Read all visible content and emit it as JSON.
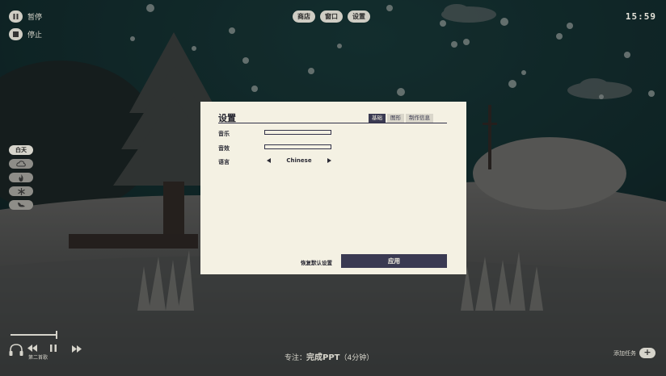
{
  "topbar": {
    "pause_label": "暂停",
    "stop_label": "停止",
    "tabs": [
      {
        "label": "商店"
      },
      {
        "label": "窗口"
      },
      {
        "label": "设置"
      }
    ],
    "clock": "15:59"
  },
  "sidebar": {
    "scene_label": "白天",
    "icons": [
      "cloud-icon",
      "fire-icon",
      "snowflake-icon",
      "bird-icon"
    ]
  },
  "settings": {
    "title": "设置",
    "tabs": [
      {
        "label": "基础",
        "active": true
      },
      {
        "label": "图形",
        "active": false
      },
      {
        "label": "制作信息",
        "active": false
      }
    ],
    "music_label": "音乐",
    "music_level": 0,
    "sfx_label": "音效",
    "sfx_level": 0,
    "language_label": "语言",
    "language_value": "Chinese",
    "reset_label": "恢复默认设置",
    "apply_label": "应用"
  },
  "player": {
    "track_label": "第二首歌",
    "progress": 1.0
  },
  "focus": {
    "prefix": "专注：",
    "task": "完成PPT",
    "duration": "（4分钟）"
  },
  "add_task_label": "添加任务",
  "colors": {
    "panel": "#f4f1e3",
    "accent": "#3a3a52",
    "sky": "#1f4a4a"
  }
}
